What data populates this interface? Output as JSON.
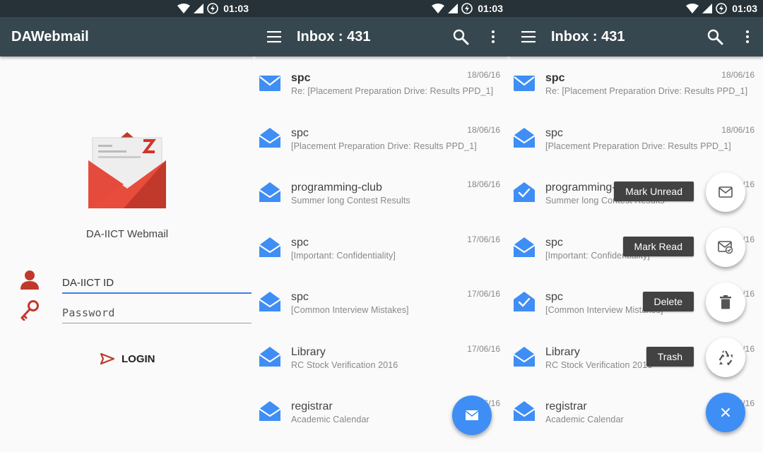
{
  "statusbar": {
    "time": "01:03"
  },
  "login": {
    "app_title": "DAWebmail",
    "app_name": "DA-IICT Webmail",
    "id_placeholder": "DA-IICT ID",
    "password_placeholder": "Password",
    "login_label": "LOGIN"
  },
  "inbox": {
    "title": "Inbox : 431",
    "emails": [
      {
        "sender": "spc",
        "subject": "Re: [Placement Preparation Drive: Results PPD_1]",
        "date": "18/06/16",
        "unread": true
      },
      {
        "sender": "spc",
        "subject": "[Placement Preparation Drive: Results PPD_1]",
        "date": "18/06/16",
        "unread": false
      },
      {
        "sender": "programming-club",
        "subject": "Summer long Contest Results",
        "date": "18/06/16",
        "unread": false
      },
      {
        "sender": "spc",
        "subject": "[Important: Confidentiality]",
        "date": "17/06/16",
        "unread": false
      },
      {
        "sender": "spc",
        "subject": "[Common Interview Mistakes]",
        "date": "17/06/16",
        "unread": false
      },
      {
        "sender": "Library",
        "subject": "RC Stock Verification 2016",
        "date": "17/06/16",
        "unread": false
      },
      {
        "sender": "registrar",
        "subject": "Academic Calendar",
        "date": "17/06/16",
        "unread": false
      }
    ]
  },
  "actions": {
    "mark_unread": "Mark Unread",
    "mark_read": "Mark Read",
    "delete": "Delete",
    "trash": "Trash"
  },
  "colors": {
    "statusbar": "#263238",
    "appbar": "#37474f",
    "accent": "#3f8ef5",
    "brand_red": "#e74c3c"
  },
  "icons": {
    "menu": "menu-icon",
    "search": "search-icon",
    "more": "more-vert-icon",
    "compose": "envelope-icon",
    "close": "close-icon"
  }
}
